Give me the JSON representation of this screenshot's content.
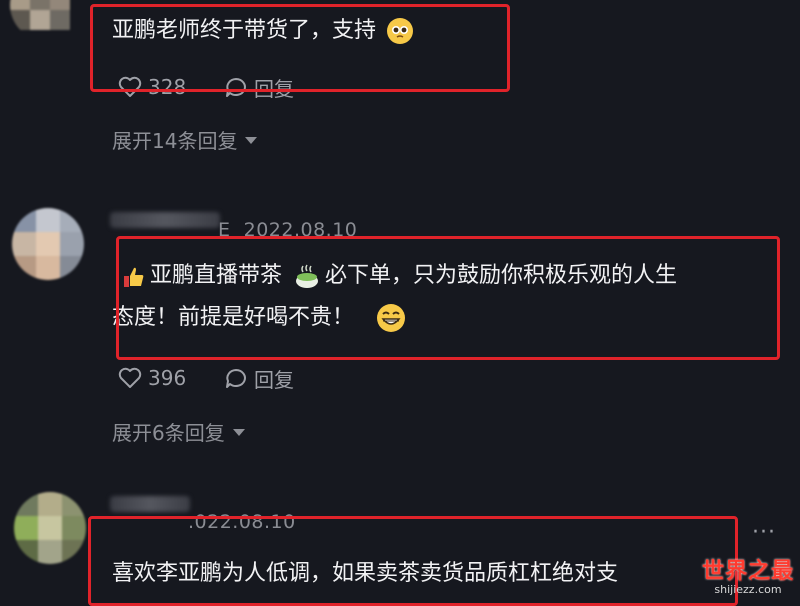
{
  "comments": [
    {
      "text": "亚鹏老师终于带货了，支持",
      "emoji": "pleading-face-icon",
      "likes": "328",
      "reply_label": "回复",
      "expand_label": "展开14条回复"
    },
    {
      "username_suffix": "E",
      "date": "2022.08.10",
      "text_line1": "亚鹏直播带茶",
      "text_line1b": "必下单，只为鼓励你积极乐观的人生",
      "text_line2": "态度！前提是好喝不贵！",
      "likes": "396",
      "reply_label": "回复",
      "expand_label": "展开6条回复"
    },
    {
      "date": ".022.08.10",
      "text": "喜欢李亚鹏为人低调，如果卖茶卖货品质杠杠绝对支"
    }
  ],
  "more_label": "···",
  "watermark": {
    "title": "世界之最",
    "url": "shijiezz.com"
  },
  "colors": {
    "background": "#16181f",
    "highlight": "#e0232a",
    "text": "#f2f2f4",
    "muted": "#9fa1a8"
  }
}
